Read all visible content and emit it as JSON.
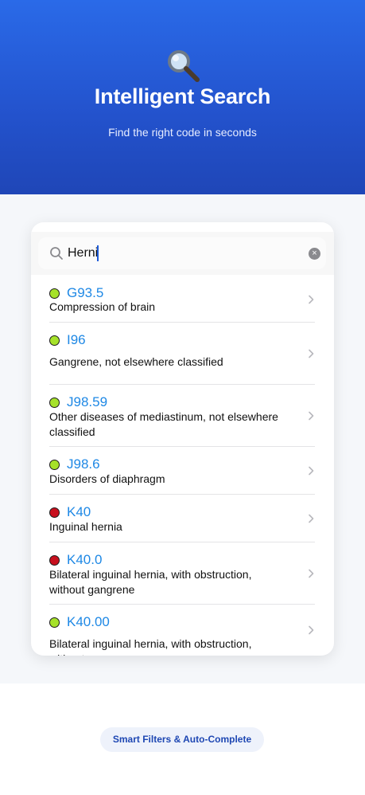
{
  "hero": {
    "title": "Intelligent Search",
    "subtitle": "Find the right code in seconds",
    "icon": "magnifying-glass-icon"
  },
  "search": {
    "value": "Herni",
    "clear_label": "×"
  },
  "results": [
    {
      "code": "G93.5",
      "desc": "Compression of brain",
      "status": "green"
    },
    {
      "code": "I96",
      "desc": "Gangrene, not elsewhere classified",
      "status": "green"
    },
    {
      "code": "J98.59",
      "desc": "Other diseases of mediastinum, not elsewhere classified",
      "status": "green"
    },
    {
      "code": "J98.6",
      "desc": "Disorders of diaphragm",
      "status": "green"
    },
    {
      "code": "K40",
      "desc": "Inguinal hernia",
      "status": "red"
    },
    {
      "code": "K40.0",
      "desc": "Bilateral inguinal hernia, with obstruction, without gangrene",
      "status": "red"
    },
    {
      "code": "K40.00",
      "desc": "Bilateral inguinal hernia, with obstruction, without",
      "status": "green"
    }
  ],
  "colors": {
    "green": "#a6e22a",
    "red": "#c8101e",
    "code_blue": "#1e88e5",
    "hero_blue": "#2352cc"
  },
  "footer": {
    "pill_label": "Smart Filters & Auto-Complete"
  }
}
